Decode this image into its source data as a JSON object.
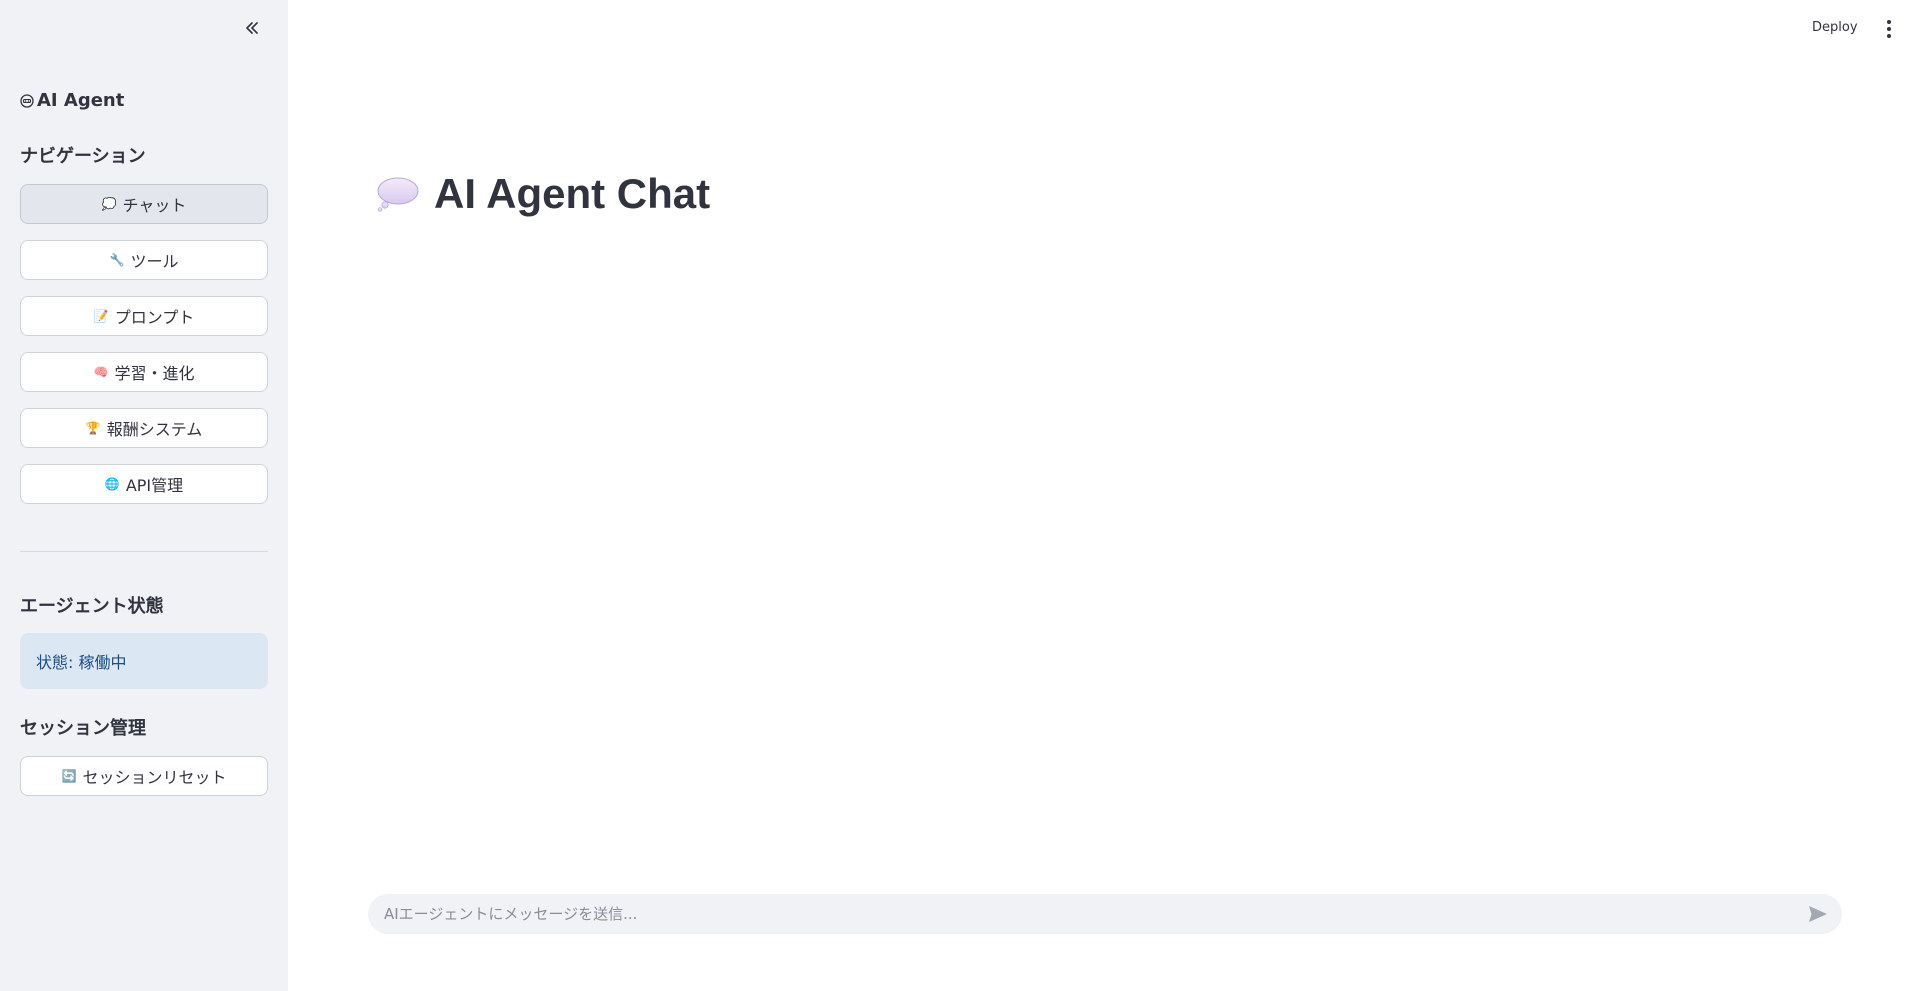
{
  "sidebar": {
    "collapse_icon": "double-chevron-left-icon",
    "brand": {
      "icon": "robot-icon",
      "label": "AI Agent"
    },
    "nav_title": "ナビゲーション",
    "nav_items": [
      {
        "icon": "speech-bubble-icon",
        "glyph": "💭",
        "label": "チャット",
        "active": true
      },
      {
        "icon": "wrench-icon",
        "glyph": "🔧",
        "label": "ツール",
        "active": false
      },
      {
        "icon": "memo-icon",
        "glyph": "📝",
        "label": "プロンプト",
        "active": false
      },
      {
        "icon": "brain-icon",
        "glyph": "🧠",
        "label": "学習・進化",
        "active": false
      },
      {
        "icon": "trophy-icon",
        "glyph": "🏆",
        "label": "報酬システム",
        "active": false
      },
      {
        "icon": "globe-icon",
        "glyph": "🌐",
        "label": "API管理",
        "active": false
      }
    ],
    "status_title": "エージェント状態",
    "status_text": "状態: 稼働中",
    "session_title": "セッション管理",
    "session_reset": {
      "icon": "refresh-icon",
      "glyph": "🔄",
      "label": "セッションリセット"
    }
  },
  "topbar": {
    "deploy_label": "Deploy",
    "menu_icon": "vertical-ellipsis-icon"
  },
  "main": {
    "title_icon": "speech-bubble-icon",
    "title": "AI Agent Chat"
  },
  "chat": {
    "placeholder": "AIエージェントにメッセージを送信...",
    "value": "",
    "send_icon": "send-icon"
  },
  "colors": {
    "sidebar_bg": "#f0f2f6",
    "status_bg": "#dce7f4",
    "status_text": "#1e4d82",
    "text": "#31333f"
  }
}
